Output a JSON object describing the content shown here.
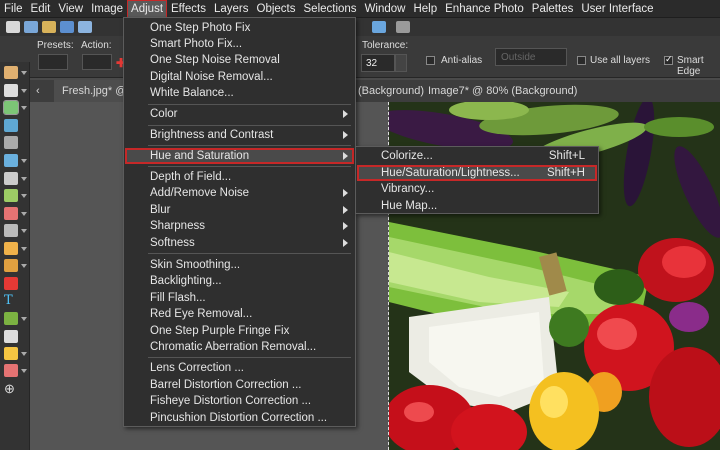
{
  "menubar": {
    "items": [
      "File",
      "Edit",
      "View",
      "Image",
      "Adjust",
      "Effects",
      "Layers",
      "Objects",
      "Selections",
      "Window",
      "Help",
      "Enhance Photo",
      "Palettes",
      "User Interface"
    ]
  },
  "options": {
    "presets_label": "Presets:",
    "action_label": "Action:",
    "tolerance_label": "Tolerance:",
    "tolerance_value": "32",
    "antialias_label": "Anti-alias",
    "mode_value": "Outside",
    "use_all_layers_label": "Use all layers",
    "smart_edge_label": "Smart Edge"
  },
  "tabs": {
    "current": "Fresh.jpg* @",
    "background_suffix": "(Background)",
    "other": "Image7* @  80% (Background)"
  },
  "adjust_menu": {
    "items": [
      "One Step Photo Fix",
      "Smart Photo Fix...",
      "One Step Noise Removal",
      "Digital Noise Removal...",
      "White Balance...",
      "Color",
      "Brightness and Contrast",
      "Hue and Saturation",
      "Depth of Field...",
      "Add/Remove Noise",
      "Blur",
      "Sharpness",
      "Softness",
      "Skin Smoothing...",
      "Backlighting...",
      "Fill Flash...",
      "Red Eye Removal...",
      "One Step Purple Fringe Fix",
      "Chromatic Aberration Removal...",
      "Lens Correction ...",
      "Barrel Distortion Correction ...",
      "Fisheye Distortion Correction ...",
      "Pincushion Distortion Correction ..."
    ]
  },
  "hue_submenu": {
    "items": [
      {
        "label": "Colorize...",
        "shortcut": "Shift+L"
      },
      {
        "label": "Hue/Saturation/Lightness...",
        "shortcut": "Shift+H"
      },
      {
        "label": "Vibrancy...",
        "shortcut": ""
      },
      {
        "label": "Hue Map...",
        "shortcut": ""
      }
    ]
  },
  "colors": {
    "highlight_outline": "#c62828",
    "menu_bg": "#2f2f2f",
    "app_bg": "#4a4a4a"
  }
}
